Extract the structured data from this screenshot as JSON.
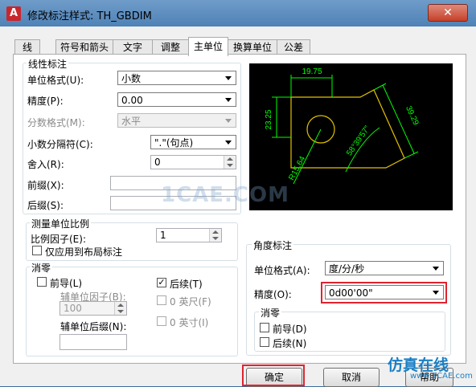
{
  "window": {
    "title": "修改标注样式: TH_GBDIM",
    "app_icon_letter": "A",
    "close_glyph": "✕"
  },
  "tabs": [
    {
      "label": "线"
    },
    {
      "label": "符号和箭头"
    },
    {
      "label": "文字"
    },
    {
      "label": "调整"
    },
    {
      "label": "主单位"
    },
    {
      "label": "换算单位"
    },
    {
      "label": "公差"
    }
  ],
  "active_tab": "主单位",
  "linear": {
    "group_label": "线性标注",
    "unit_format_label": "单位格式(U):",
    "unit_format_value": "小数",
    "precision_label": "精度(P):",
    "precision_value": "0.00",
    "fraction_label": "分数格式(M):",
    "fraction_value": "水平",
    "decimal_sep_label": "小数分隔符(C):",
    "decimal_sep_value": "\".\"(句点)",
    "round_label": "舍入(R):",
    "round_value": "0",
    "prefix_label": "前缀(X):",
    "suffix_label": "后缀(S):"
  },
  "scale": {
    "group_label": "测量单位比例",
    "factor_label": "比例因子(E):",
    "factor_value": "1",
    "layout_only_label": "仅应用到布局标注"
  },
  "zero_linear": {
    "group_label": "消零",
    "leading_label": "前导(L)",
    "leading_checked": false,
    "trailing_label": "后续(T)",
    "trailing_checked": true,
    "sub_factor_label": "辅单位因子(B):",
    "sub_factor_value": "100",
    "feet_label": "0 英尺(F)",
    "inch_label": "0 英寸(I)",
    "sub_suffix_label": "辅单位后缀(N):"
  },
  "angular": {
    "group_label": "角度标注",
    "unit_format_label": "单位格式(A):",
    "unit_format_value": "度/分/秒",
    "precision_label": "精度(O):",
    "precision_value": "0d00'00\""
  },
  "zero_angular": {
    "group_label": "消零",
    "leading_label": "前导(D)",
    "trailing_label": "后续(N)"
  },
  "preview": {
    "dims": [
      "19.75",
      "23.25",
      "39.29",
      "58°39'57\"",
      "R15.64"
    ],
    "dim_color": "#00ff00",
    "geom_color": "#e3c200"
  },
  "buttons": {
    "ok": "确定",
    "cancel": "取消",
    "help": "帮助"
  },
  "overlay": {
    "watermark": "1CAE.COM",
    "brand": "仿真在线",
    "brand_url": "www.1CAE.com"
  },
  "colors": {
    "highlight": "#e0232e",
    "titlebar": "#4f82b6"
  }
}
